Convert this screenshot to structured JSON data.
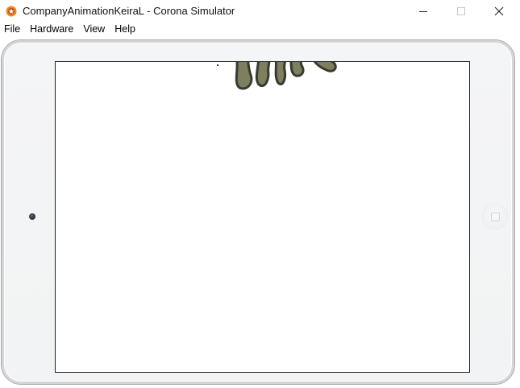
{
  "window": {
    "title": "CompanyAnimationKeiraL - Corona Simulator"
  },
  "menubar": {
    "items": [
      "File",
      "Hardware",
      "View",
      "Help"
    ]
  },
  "colors": {
    "app_icon": "#f08a24",
    "creature_fill": "#7d7f5f",
    "creature_stroke": "#3a3a30",
    "screen_border": "#222222"
  },
  "icons": {
    "app": "corona-app-icon",
    "minimize": "minimize-icon",
    "maximize": "maximize-icon",
    "close": "close-icon"
  }
}
